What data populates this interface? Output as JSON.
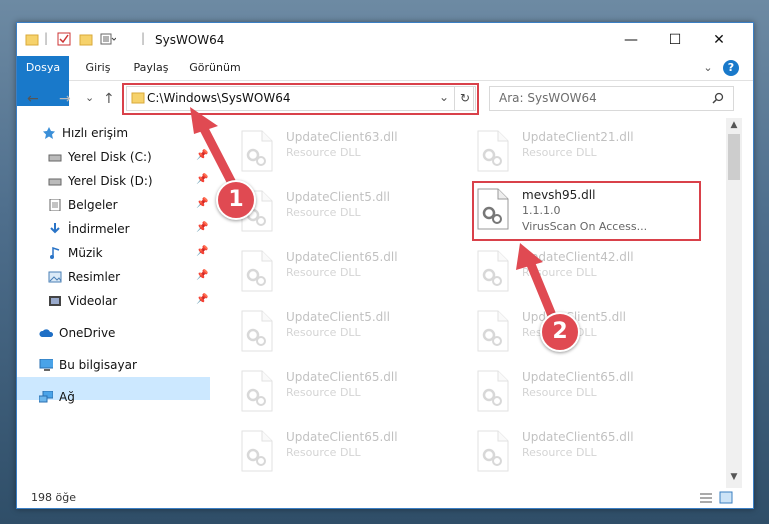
{
  "window": {
    "title": "SysWOW64",
    "controls": {
      "minimize": "—",
      "maximize": "☐",
      "close": "✕"
    }
  },
  "ribbon": {
    "tabs": [
      {
        "label": "Dosya"
      },
      {
        "label": "Giriş"
      },
      {
        "label": "Paylaş"
      },
      {
        "label": "Görünüm"
      }
    ],
    "help": "?"
  },
  "nav": {
    "back": "←",
    "forward": "→",
    "recent": "⌄",
    "up": "↑",
    "address": "C:\\Windows\\SysWOW64",
    "refresh": "↻",
    "search_placeholder": "Ara: SysWOW64"
  },
  "sidebar": {
    "items": [
      {
        "label": "Hızlı erişim",
        "icon": "star-icon"
      },
      {
        "label": "Yerel Disk (C:)",
        "icon": "drive-icon",
        "pinned": true
      },
      {
        "label": "Yerel Disk (D:)",
        "icon": "drive-icon",
        "pinned": true
      },
      {
        "label": "Belgeler",
        "icon": "documents-icon",
        "pinned": true
      },
      {
        "label": "İndirmeler",
        "icon": "download-icon",
        "pinned": true
      },
      {
        "label": "Müzik",
        "icon": "music-icon",
        "pinned": true
      },
      {
        "label": "Resimler",
        "icon": "pictures-icon",
        "pinned": true
      },
      {
        "label": "Videolar",
        "icon": "videos-icon",
        "pinned": true
      },
      {
        "label": "OneDrive",
        "icon": "cloud-icon"
      },
      {
        "label": "Bu bilgisayar",
        "icon": "computer-icon",
        "selected": true
      },
      {
        "label": "Ağ",
        "icon": "network-icon"
      }
    ]
  },
  "files": {
    "left": [
      {
        "name": "UpdateClient63.dll",
        "type": "Resource DLL"
      },
      {
        "name": "UpdateClient5.dll",
        "type": "Resource DLL"
      },
      {
        "name": "UpdateClient65.dll",
        "type": "Resource DLL"
      },
      {
        "name": "UpdateClient5.dll",
        "type": "Resource DLL"
      },
      {
        "name": "UpdateClient65.dll",
        "type": "Resource DLL"
      },
      {
        "name": "UpdateClient65.dll",
        "type": "Resource DLL"
      }
    ],
    "right": [
      {
        "name": "UpdateClient21.dll",
        "type": "Resource DLL"
      },
      {
        "name": "mevsh95.dll",
        "version": "1.1.1.0",
        "desc": "VirusScan On Access...",
        "highlight": true
      },
      {
        "name": "UpdateClient42.dll",
        "type": "Resource DLL"
      },
      {
        "name": "UpdateClient5.dll",
        "type": "Resource DLL"
      },
      {
        "name": "UpdateClient65.dll",
        "type": "Resource DLL"
      },
      {
        "name": "UpdateClient65.dll",
        "type": "Resource DLL"
      }
    ]
  },
  "status": {
    "count": "198 öğe"
  },
  "annotations": {
    "step1": "1",
    "step2": "2",
    "color": "#d9414a"
  }
}
